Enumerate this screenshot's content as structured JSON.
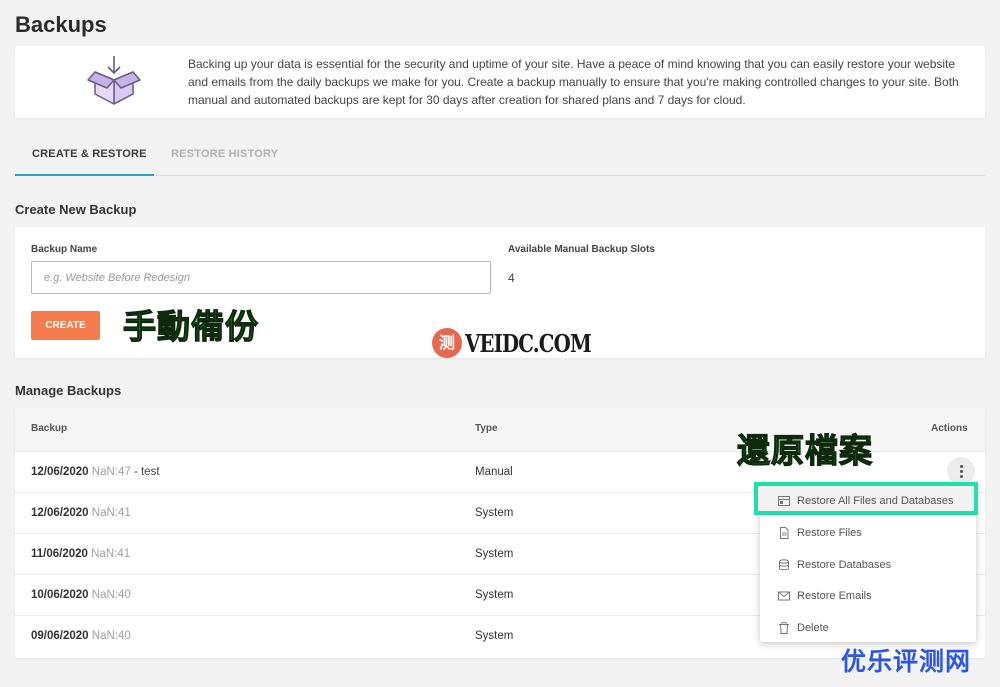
{
  "page": {
    "title": "Backups"
  },
  "info": {
    "text": "Backing up your data is essential for the security and uptime of your site. Have a peace of mind knowing that you can easily restore your website and emails from the daily backups we make for you. Create a backup manually to ensure that you're making controlled changes to your site. Both manual and automated backups are kept for 30 days after creation for shared plans and 7 days for cloud.",
    "icon": "box-download-icon"
  },
  "tabs": [
    {
      "label": "CREATE & RESTORE",
      "active": true
    },
    {
      "label": "RESTORE HISTORY",
      "active": false
    }
  ],
  "create": {
    "section_title": "Create New Backup",
    "name_label": "Backup Name",
    "name_placeholder": "e.g. Website Before Redesign",
    "name_value": "",
    "slots_label": "Available Manual Backup Slots",
    "slots_value": "4",
    "button_label": "CREATE"
  },
  "manage": {
    "section_title": "Manage Backups",
    "columns": {
      "backup": "Backup",
      "type": "Type",
      "actions": "Actions"
    },
    "rows": [
      {
        "date": "12/06/2020",
        "time": "NaN:47",
        "note": " - test",
        "type": "Manual"
      },
      {
        "date": "12/06/2020",
        "time": "NaN:41",
        "note": "",
        "type": "System"
      },
      {
        "date": "11/06/2020",
        "time": "NaN:41",
        "note": "",
        "type": "System"
      },
      {
        "date": "10/06/2020",
        "time": "NaN:40",
        "note": "",
        "type": "System"
      },
      {
        "date": "09/06/2020",
        "time": "NaN:40",
        "note": "",
        "type": "System"
      }
    ]
  },
  "actions_menu": {
    "items": [
      {
        "label": "Restore All Files and Databases",
        "icon": "restore-all-icon",
        "highlighted": true
      },
      {
        "label": "Restore Files",
        "icon": "file-icon"
      },
      {
        "label": "Restore Databases",
        "icon": "database-icon"
      },
      {
        "label": "Restore Emails",
        "icon": "mail-icon"
      },
      {
        "label": "Delete",
        "icon": "trash-icon"
      }
    ]
  },
  "overlays": {
    "manual_backup": "手動備份",
    "restore_files": "還原檔案",
    "watermark_circle": "测",
    "watermark_text": "VEIDC.COM",
    "watermark_bottom": "优乐评测网"
  },
  "colors": {
    "accent_tab": "#27a5c8",
    "create_button": "#f47c4d",
    "overlay_green": "#39e432",
    "highlight_border": "#1fe0a8",
    "watermark_blue": "#2c55e6"
  }
}
